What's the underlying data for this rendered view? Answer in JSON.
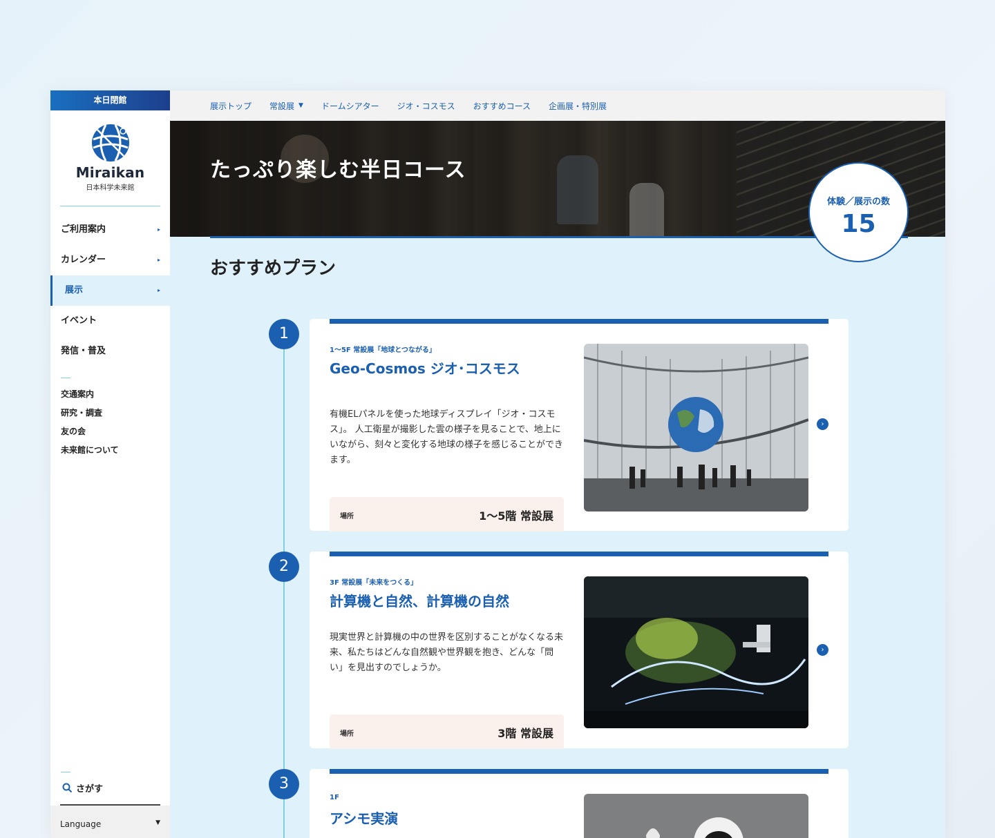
{
  "sidebar": {
    "closed_banner": "本日閉館",
    "logo_name": "Miraikan",
    "logo_sub": "日本科学未来館",
    "main_items": [
      {
        "label": "ご利用案内",
        "arrow": "▸"
      },
      {
        "label": "カレンダー",
        "arrow": "▸"
      },
      {
        "label": "展示",
        "arrow": "▸"
      },
      {
        "label": "イベント"
      },
      {
        "label": "発信・普及"
      }
    ],
    "sub_items": [
      "交通案内",
      "研究・調査",
      "友の会",
      "未来館について"
    ],
    "search_label": "さがす",
    "language_label": "Language",
    "language_caret": "▼"
  },
  "topnav": {
    "items": [
      "展示トップ",
      "常設展",
      "ドームシアター",
      "ジオ・コスモス",
      "おすすめコース",
      "企画展・特別展"
    ],
    "dropdown_caret": "▼"
  },
  "hero": {
    "title": "たっぷり楽しむ半日コース",
    "count_label": "体験／展示の数",
    "count_value": "15"
  },
  "section_title": "おすすめプラン",
  "plans": [
    {
      "step": "1",
      "tag": "1〜5F 常設展「地球とつながる」",
      "title": "Geo-Cosmos ジオ･コスモス",
      "description": "有機ELパネルを使った地球ディスプレイ「ジオ・コスモス」。 人工衛星が撮影した雲の様子を見ることで、地上にいながら、刻々と変化する地球の様子を感じることができます。",
      "place_label": "場所",
      "place_value": "1〜5階 常設展",
      "go": "›"
    },
    {
      "step": "2",
      "tag": "3F 常設展「未来をつくる」",
      "title": "計算機と自然、計算機の自然",
      "description": "現実世界と計算機の中の世界を区別することがなくなる未来、私たちはどんな自然観や世界観を抱き、どんな「問い」を見出すのでしょうか。",
      "place_label": "場所",
      "place_value": "3階 常設展",
      "go": "›"
    },
    {
      "step": "3",
      "tag": "1F",
      "title": "アシモ実演"
    }
  ],
  "colors": {
    "accent": "#1a5fb0",
    "timeline": "#7fd0dd",
    "panel_bg": "#dff1fb",
    "place_bg": "#fbf1ec"
  }
}
